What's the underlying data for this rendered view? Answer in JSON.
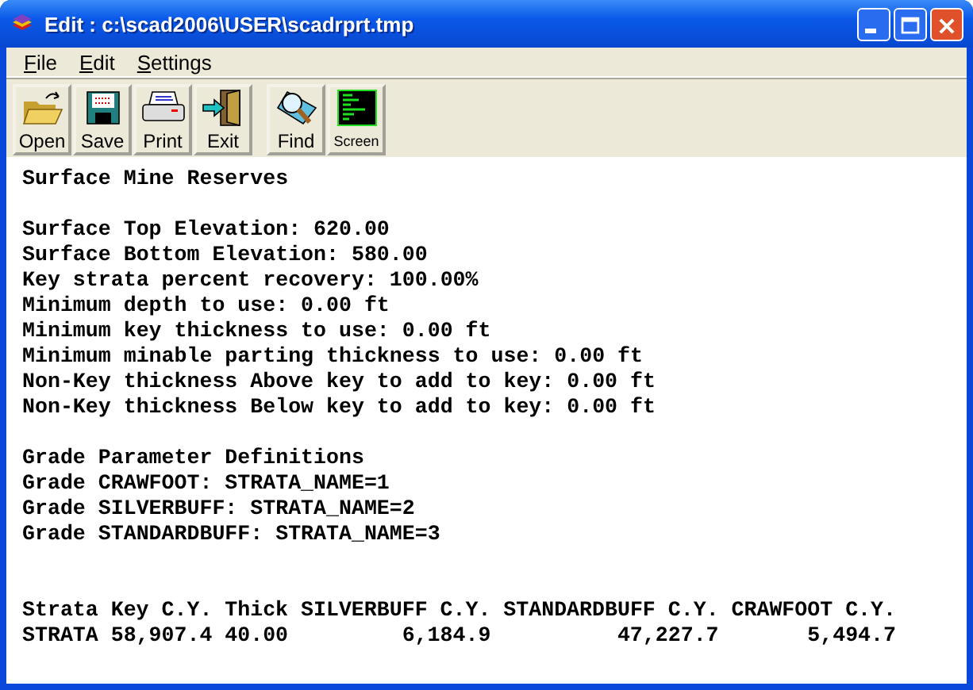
{
  "window": {
    "title": "Edit : c:\\scad2006\\USER\\scadrprt.tmp"
  },
  "menu": [
    "File",
    "Edit",
    "Settings"
  ],
  "toolbar": [
    {
      "label": "Open",
      "kind": "open"
    },
    {
      "label": "Save",
      "kind": "save"
    },
    {
      "label": "Print",
      "kind": "print"
    },
    {
      "label": "Exit",
      "kind": "exit"
    },
    {
      "label": "Find",
      "kind": "find"
    },
    {
      "label": "Screen",
      "kind": "screen"
    }
  ],
  "sections": [
    {
      "lines": [
        "Surface Mine Reserves"
      ]
    },
    {
      "lines": [
        "Surface Top Elevation: 620.00",
        "Surface Bottom Elevation: 580.00",
        "Key strata percent recovery: 100.00%",
        "Minimum depth to use: 0.00 ft",
        "Minimum key thickness to use: 0.00 ft",
        "Minimum minable parting thickness to use: 0.00 ft",
        "Non-Key thickness Above key to add to key: 0.00 ft",
        "Non-Key thickness Below key to add to key: 0.00 ft"
      ]
    },
    {
      "lines": [
        "Grade Parameter Definitions",
        "Grade CRAWFOOT: STRATA_NAME=1",
        "Grade SILVERBUFF: STRATA_NAME=2",
        "Grade STANDARDBUFF: STRATA_NAME=3"
      ]
    }
  ],
  "table": {
    "columns": [
      {
        "label": "Strata",
        "kind": "text"
      },
      {
        "label": "Key C.Y.",
        "kind": "text"
      },
      {
        "label": "Thick",
        "kind": "text"
      },
      {
        "label": "SILVERBUFF C.Y.",
        "kind": "number"
      },
      {
        "label": "STANDARDBUFF C.Y.",
        "kind": "number"
      },
      {
        "label": "CRAWFOOT C.Y.",
        "kind": "number"
      }
    ],
    "rows": [
      [
        "STRATA",
        "58,907.4",
        "40.00",
        "6,184.9",
        "47,227.7",
        "5,494.7"
      ]
    ]
  }
}
